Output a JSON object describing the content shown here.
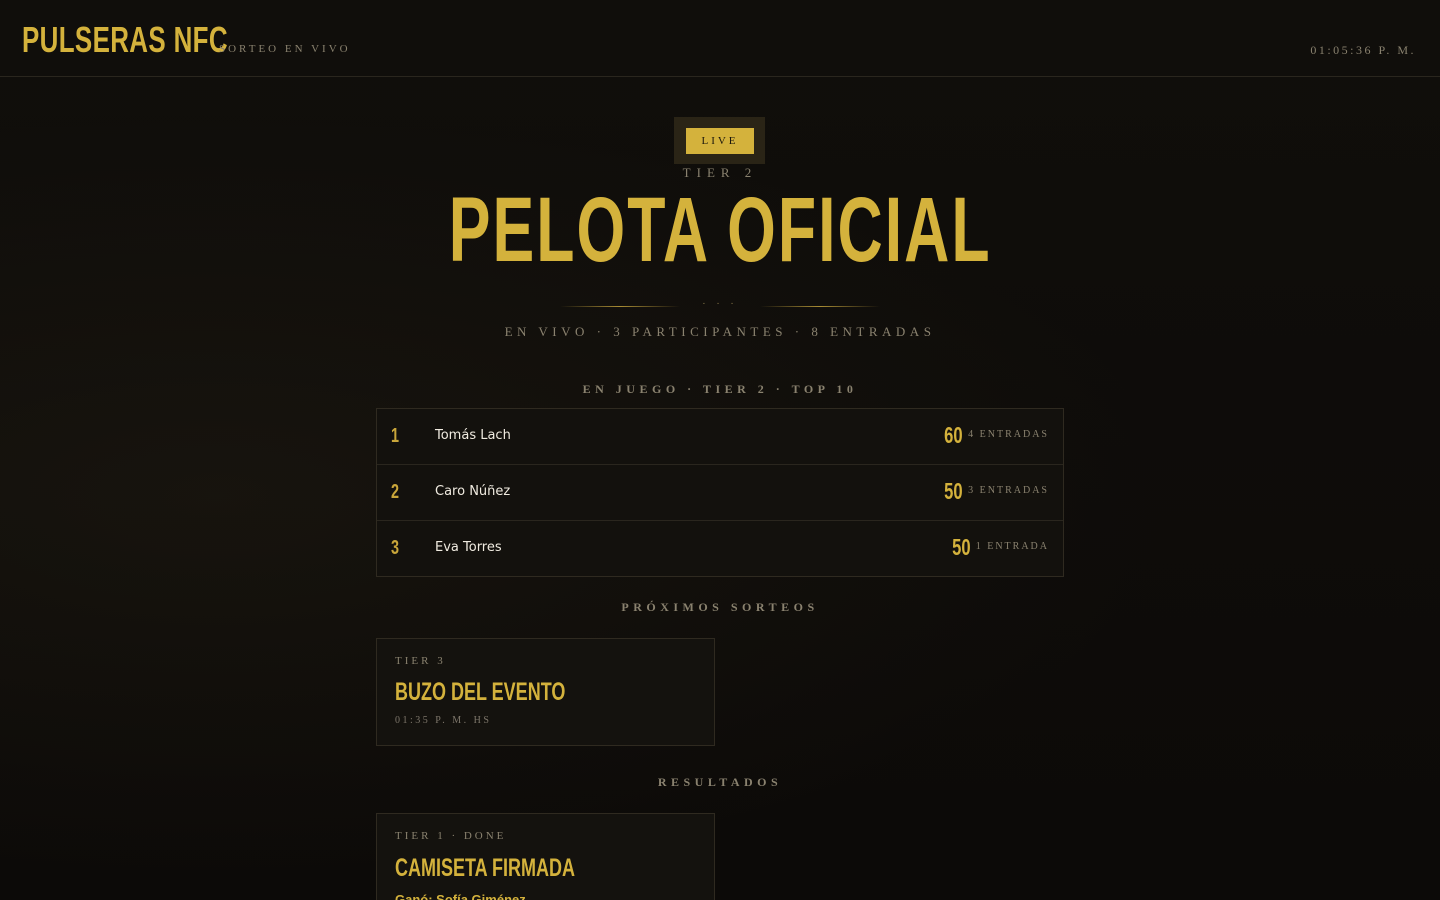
{
  "header": {
    "brand": "PULSERAS NFC",
    "subtitle": "SORTEO EN VIVO",
    "clock": "01:05:36 P. M."
  },
  "hero": {
    "badge": "LIVE",
    "tier": "TIER 2",
    "title": "PELOTA OFICIAL",
    "divider_dots": "· · ·",
    "meta": "EN VIVO · 3 PARTICIPANTES · 8 ENTRADAS"
  },
  "leaderboard": {
    "title": "EN JUEGO · TIER 2 · TOP 10",
    "rows": [
      {
        "rank": "1",
        "name": "Tomás Lach",
        "score": "60",
        "entries": "4 ENTRADAS"
      },
      {
        "rank": "2",
        "name": "Caro Núñez",
        "score": "50",
        "entries": "3 ENTRADAS"
      },
      {
        "rank": "3",
        "name": "Eva Torres",
        "score": "50",
        "entries": "1 ENTRADA"
      }
    ]
  },
  "upcoming": {
    "title": "PRÓXIMOS SORTEOS",
    "cards": [
      {
        "tier": "TIER 3",
        "name": "BUZO DEL EVENTO",
        "time": "01:35 P. M. HS"
      }
    ]
  },
  "results": {
    "title": "RESULTADOS",
    "cards": [
      {
        "tier": "TIER 1 · DONE",
        "name": "CAMISETA FIRMADA",
        "winner": "Ganó: Sofía Giménez"
      }
    ]
  },
  "colors": {
    "accent": "#d4b23c",
    "background": "#0e0c09",
    "muted_text": "#8a826f"
  }
}
